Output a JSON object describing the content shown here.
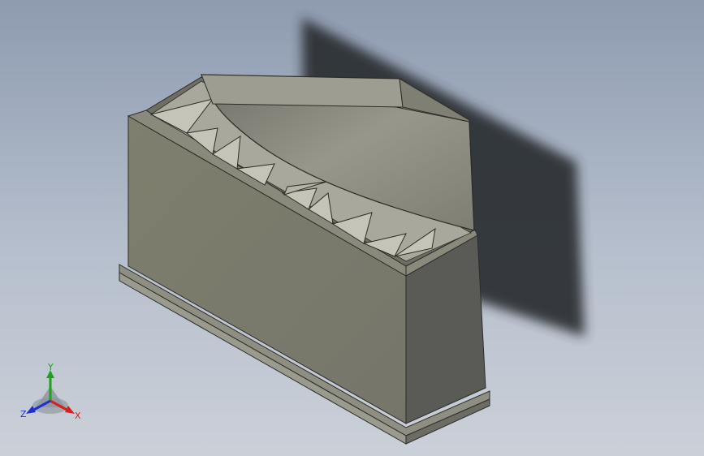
{
  "viewport": {
    "background_top": "#8e9bb0",
    "background_bottom": "#cbd0d8"
  },
  "model": {
    "body_color": "#7d7d6c",
    "side_color": "#5a5a56",
    "lid_color": "#8b8b80",
    "shadow_color": "#2a2e33"
  },
  "triad": {
    "x_label": "X",
    "y_label": "Y",
    "z_label": "Z",
    "x_color": "#d42020",
    "y_color": "#1fa01f",
    "z_color": "#2030d0"
  }
}
